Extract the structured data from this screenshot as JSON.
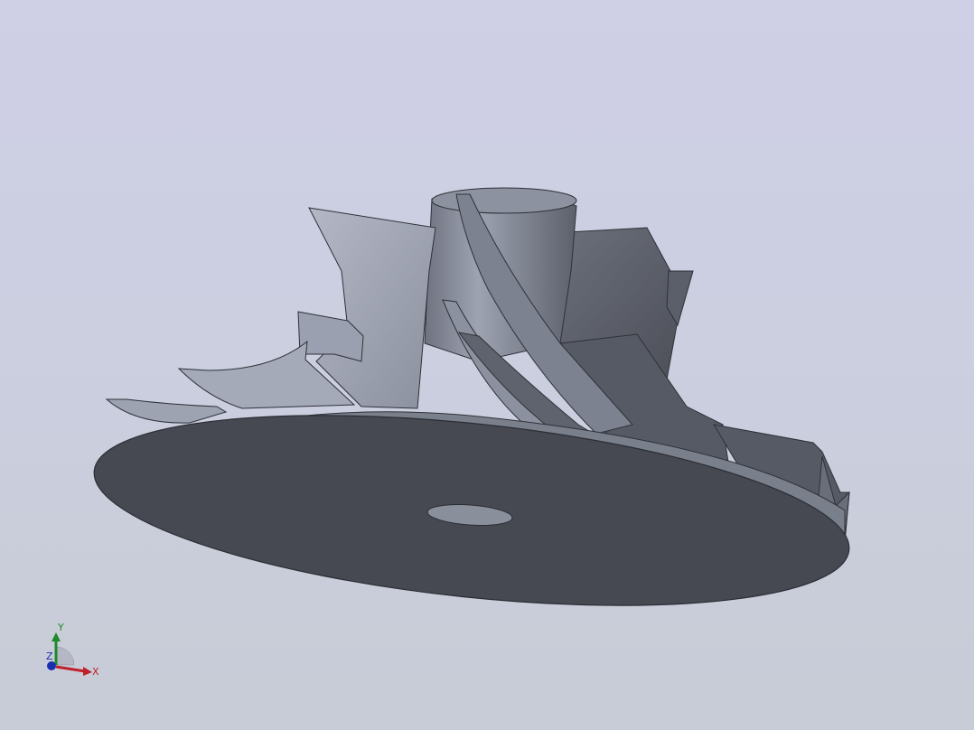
{
  "viewport": {
    "background_top": "#cfcfe6",
    "background_bottom": "#c8ccd6"
  },
  "model": {
    "name": "impeller",
    "body_color": "#4a4d56",
    "blade_light_color": "#a3a8b8",
    "blade_dark_color": "#5a5e68"
  },
  "triad": {
    "x_label": "X",
    "y_label": "Y",
    "z_label": "Z",
    "x_color": "#c0202a",
    "y_color": "#1e8a2a",
    "z_color": "#1a2fb0"
  }
}
